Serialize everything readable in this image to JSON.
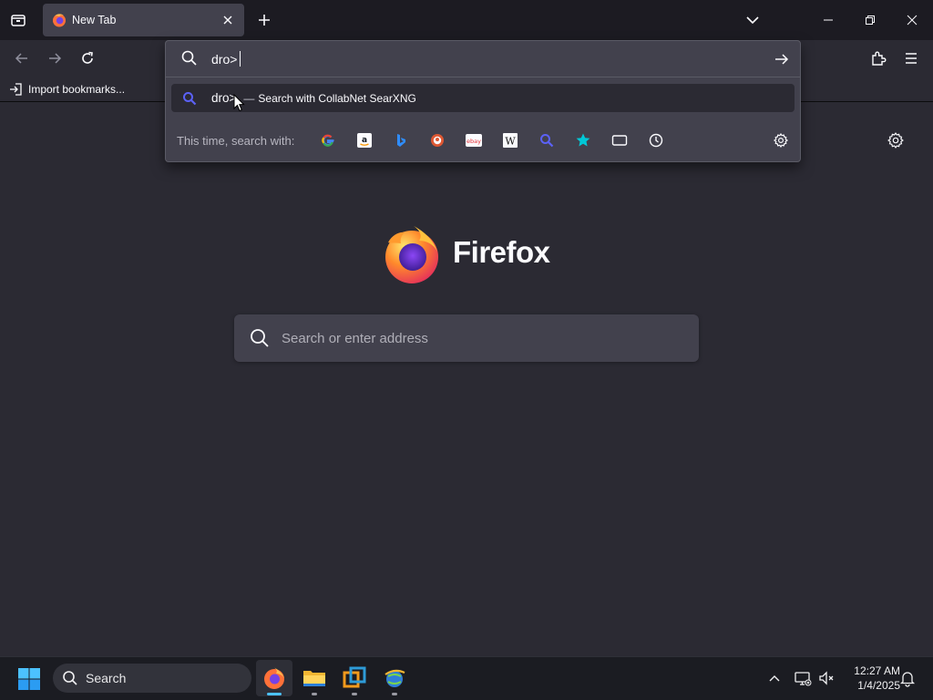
{
  "tab": {
    "title": "New Tab"
  },
  "bookmarks": {
    "import_label": "Import bookmarks..."
  },
  "urlbar": {
    "typed_text": "dro>",
    "suggestion": {
      "query": "dro>",
      "separator": "—",
      "action": "Search with CollabNet SearXNG"
    },
    "oneoff_label": "This time, search with:",
    "oneoff_engines": [
      "Google",
      "Amazon",
      "Bing",
      "DuckDuckGo",
      "eBay",
      "Wikipedia",
      "CollabNet SearXNG",
      "Bookmarks",
      "Tabs",
      "History"
    ]
  },
  "newtab": {
    "brand": "Firefox",
    "search_placeholder": "Search or enter address"
  },
  "taskbar": {
    "search_label": "Search",
    "apps": [
      "Firefox",
      "File Explorer",
      "VMware",
      "Network app"
    ],
    "clock_time": "12:27 AM",
    "clock_date": "1/4/2025"
  },
  "colors": {
    "chrome_bg": "#1c1b22",
    "toolbar_bg": "#2b2a33",
    "field_bg": "#42414d",
    "accent_blue": "#5b61f6",
    "text": "#fbfbfe"
  }
}
